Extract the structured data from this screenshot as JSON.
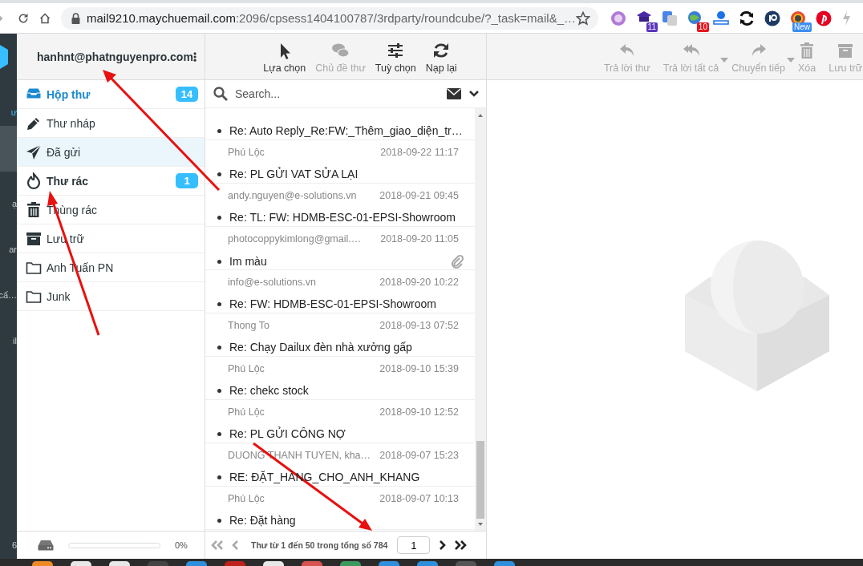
{
  "browser": {
    "url_host": "mail9210.maychuemail.com",
    "url_rest": ":2096/cpsess1404100787/3rdparty/roundcube/?_task=mail&_…",
    "extensions": [
      {
        "kind": "icon"
      },
      {
        "kind": "badged",
        "badge": "11",
        "color": "#5b35b8"
      },
      {
        "kind": "icon"
      },
      {
        "kind": "badged",
        "badge": "10",
        "color": "#e8141c"
      },
      {
        "kind": "icon"
      },
      {
        "kind": "icon"
      },
      {
        "kind": "icon"
      },
      {
        "kind": "badged",
        "badge": "New",
        "color": "#3d8ef0"
      },
      {
        "kind": "icon"
      },
      {
        "kind": "icon"
      }
    ]
  },
  "rail": {
    "items": [
      {
        "label": "ư",
        "selected": true
      },
      {
        "highlighted": true
      },
      {
        "label": "ạ"
      },
      {
        "label": "ar"
      },
      {
        "label": "cấ…"
      },
      {
        "label": "il"
      }
    ],
    "bottom_label": "6"
  },
  "folders": {
    "account": "hanhnt@phatnguyenpro.com",
    "items": [
      {
        "kind": "inbox",
        "label": "Hộp thư",
        "count": "14",
        "selected": true,
        "highlighted": false
      },
      {
        "kind": "drafts",
        "label": "Thư nháp",
        "selected": false,
        "highlighted": false
      },
      {
        "kind": "sent",
        "label": "Đã gửi",
        "selected": false,
        "highlighted": true
      },
      {
        "kind": "junk",
        "label": "Thư rác",
        "count": "1",
        "selected": false,
        "highlighted": false
      },
      {
        "kind": "trash",
        "label": "Thùng rác",
        "selected": false,
        "highlighted": false
      },
      {
        "kind": "archive",
        "label": "Lưu trữ",
        "selected": false,
        "highlighted": false
      },
      {
        "kind": "folder",
        "label": "Anh Tuấn PN",
        "selected": false,
        "highlighted": false
      },
      {
        "kind": "folder",
        "label": "Junk",
        "selected": false,
        "highlighted": false
      }
    ],
    "quota": {
      "level": 0,
      "reading": "0%"
    }
  },
  "list_toolbar": [
    {
      "kind": "select",
      "label": "Lựa chọn",
      "disabled": false
    },
    {
      "kind": "threads",
      "label": "Chủ đề thư",
      "disabled": true
    },
    {
      "kind": "options",
      "label": "Tuỳ chọn",
      "disabled": false
    },
    {
      "kind": "refresh",
      "label": "Nạp lại",
      "disabled": false
    }
  ],
  "search": {
    "placeholder": "Search..."
  },
  "messages": [
    {
      "subject": "Re: Auto Reply_Re:FW:_Thêm_giao_diện_tr…",
      "attachment": false
    },
    {
      "sender": "Phú Lộc",
      "date": "2018-09-22 11:17",
      "subject": "Re: PL GỬI VAT SỬA LẠI",
      "attachment": false
    },
    {
      "sender": "andy.nguyen@e-solutions.vn",
      "date": "2018-09-21 09:45",
      "subject": "Re: TL: FW: HDMB-ESC-01-EPSI-Showroom",
      "attachment": false
    },
    {
      "sender": "photocoppykimlong@gmail.…",
      "date": "2018-09-20 11:05",
      "subject": "Im màu",
      "attachment": true
    },
    {
      "sender": "info@e-solutions.vn",
      "date": "2018-09-20 10:22",
      "subject": "Re: FW: HDMB-ESC-01-EPSI-Showroom",
      "attachment": false
    },
    {
      "sender": "Thong To",
      "date": "2018-09-13 07:52",
      "subject": "Re: Chạy Dailux đèn nhà xưởng gấp",
      "attachment": false
    },
    {
      "sender": "Phú Lộc",
      "date": "2018-09-10 15:39",
      "subject": "Re: chekc stock",
      "attachment": false
    },
    {
      "sender": "Phú Lộc",
      "date": "2018-09-10 12:52",
      "subject": "Re: PL GỬI CÔNG NỢ",
      "attachment": false
    },
    {
      "sender": "DUONG THANH TUYEN, kha…",
      "date": "2018-09-07 15:23",
      "subject": "RE: ĐẶT_HÀNG_CHO_ANH_KHANG",
      "attachment": false
    },
    {
      "sender": "Phú Lộc",
      "date": "2018-09-07 10:13",
      "subject": "Re: Đặt hàng",
      "attachment": false
    }
  ],
  "pagination": {
    "text": "Thư từ 1 đến 50 trong tổng số 784",
    "page": "1",
    "first_disabled": true,
    "next_disabled": false
  },
  "message_toolbar": [
    {
      "kind": "reply",
      "label": "Trả lời thư",
      "disabled": true,
      "dropdown": false
    },
    {
      "kind": "reply-all",
      "label": "Trả lời tất cả",
      "disabled": true,
      "dropdown": true
    },
    {
      "kind": "forward",
      "label": "Chuyển tiếp",
      "disabled": true,
      "dropdown": true
    },
    {
      "kind": "delete",
      "label": "Xóa",
      "disabled": true,
      "dropdown": false
    },
    {
      "kind": "archive",
      "label": "Lưu trữ",
      "disabled": true,
      "dropdown": false
    }
  ]
}
